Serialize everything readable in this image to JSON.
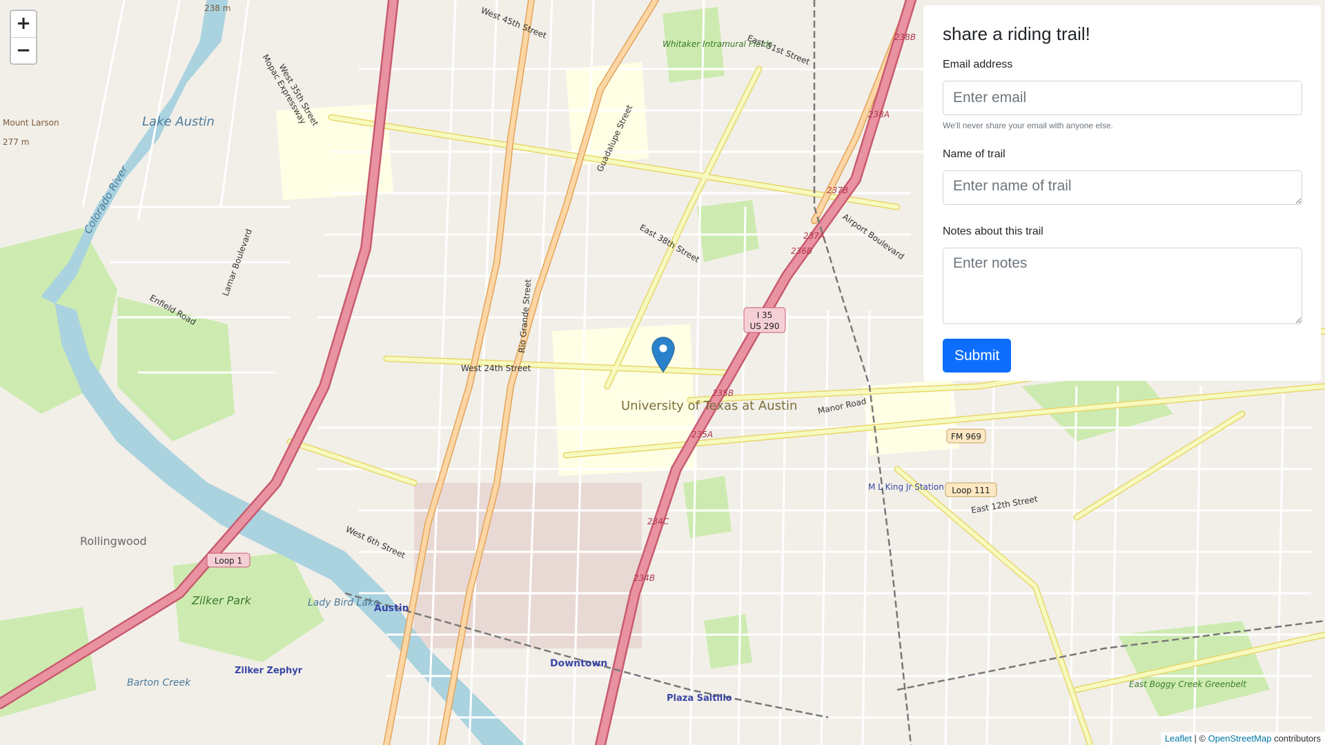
{
  "map": {
    "zoom_in": "+",
    "zoom_out": "−",
    "labels": {
      "lake_austin": "Lake Austin",
      "mount_larson": "Mount Larson",
      "mount_larson_elev": "277 m",
      "elev_238": "238 m",
      "colorado_river": "Colorado River",
      "university": "University of Texas at Austin",
      "downtown": "Downtown",
      "zilker_park": "Zilker Park",
      "zilker_zephyr": "Zilker Zephyr",
      "lady_bird_lake": "Lady Bird Lake",
      "austin": "Austin",
      "rollingwood": "Rollingwood",
      "plaza_saltillo": "Plaza Saltillo",
      "mlk_station": "M L King Jr Station",
      "whitaker": "Whitaker Intramural Fields",
      "barton_creek": "Barton Creek",
      "east_boggy": "East Boggy Creek Greenbelt",
      "i35_shield": "I 35",
      "us290_shield": "US 290",
      "loop1": "Loop 1",
      "loop111": "Loop 111",
      "fm969": "FM 969",
      "mopac": "Mopac Expressway",
      "west_24th": "West 24th Street",
      "manor_road": "Manor Road",
      "airport_blvd": "Airport Boulevard",
      "east_12th": "East 12th Street",
      "west_6th": "West 6th Street",
      "west_45th": "West 45th Street",
      "east_51st": "East 51st Street",
      "east_38th": "East 38th Street",
      "west_35th": "West 35th Street",
      "guadalupe": "Guadalupe Street",
      "lamar": "Lamar Boulevard",
      "enfield": "Enfield Road",
      "rio_grande": "Rio Grande Street",
      "tag_238b": "238B",
      "tag_238a": "238A",
      "tag_237b": "237B",
      "tag_237a": "237A",
      "tag_236b": "236B",
      "tag_235b": "235B",
      "tag_235a": "235A",
      "tag_234c": "234C",
      "tag_234b": "234B"
    }
  },
  "form": {
    "title": "share a riding trail!",
    "email_label": "Email address",
    "email_placeholder": "Enter email",
    "email_help": "We'll never share your email with anyone else.",
    "name_label": "Name of trail",
    "name_placeholder": "Enter name of trail",
    "notes_label": "Notes about this trail",
    "notes_placeholder": "Enter notes",
    "submit_label": "Submit"
  },
  "attribution": {
    "leaflet": "Leaflet",
    "separator": " | © ",
    "osm": "OpenStreetMap",
    "suffix": " contributors"
  },
  "colors": {
    "primary": "#0d6efd",
    "marker": "#2a81cb",
    "motorway": "#e892a2",
    "primary_road": "#fcd6a4",
    "secondary_road": "#f7fabf",
    "water": "#aad3df",
    "park": "#c8facc"
  }
}
